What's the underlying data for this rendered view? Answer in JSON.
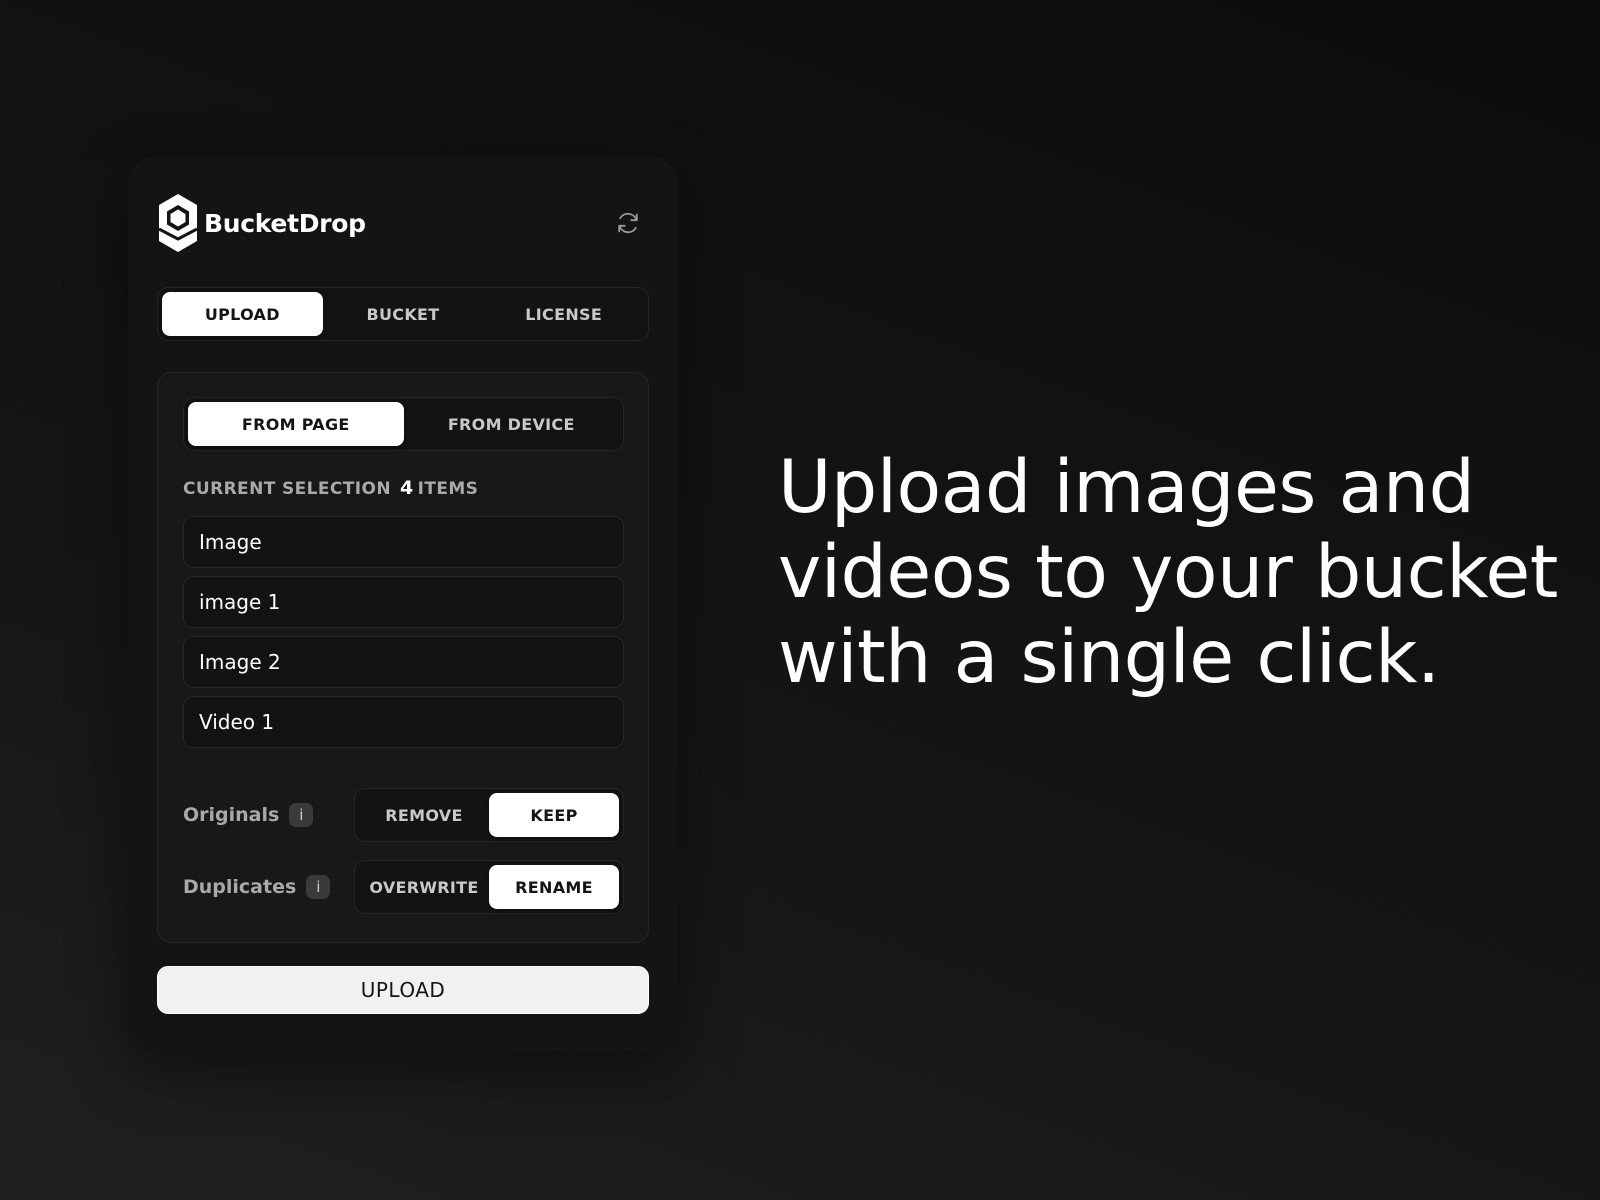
{
  "app": {
    "name": "BucketDrop",
    "logo_icon": "hexagon-logo-icon",
    "refresh_icon": "refresh-icon"
  },
  "tabs": [
    {
      "label": "UPLOAD",
      "active": true
    },
    {
      "label": "BUCKET",
      "active": false
    },
    {
      "label": "LICENSE",
      "active": false
    }
  ],
  "source": {
    "options": [
      {
        "label": "FROM PAGE",
        "active": true
      },
      {
        "label": "FROM DEVICE",
        "active": false
      }
    ]
  },
  "selection": {
    "label": "CURRENT SELECTION",
    "count": "4",
    "unit": "ITEMS",
    "items": [
      "Image",
      "image 1",
      "Image 2",
      "Video 1"
    ]
  },
  "options": {
    "originals": {
      "label": "Originals",
      "info": "i",
      "choices": [
        {
          "label": "REMOVE",
          "active": false
        },
        {
          "label": "KEEP",
          "active": true
        }
      ]
    },
    "duplicates": {
      "label": "Duplicates",
      "info": "i",
      "choices": [
        {
          "label": "OVERWRITE",
          "active": false
        },
        {
          "label": "RENAME",
          "active": true
        }
      ]
    }
  },
  "upload_button": {
    "label": "UPLOAD"
  },
  "headline": {
    "lines": [
      "Upload images and",
      "videos to your bucket",
      "with a single click."
    ]
  },
  "colors": {
    "background": "#111111",
    "panel": "#141414",
    "card": "#181818",
    "active_segment": "#ffffff",
    "muted_text": "#a9a9a9"
  }
}
